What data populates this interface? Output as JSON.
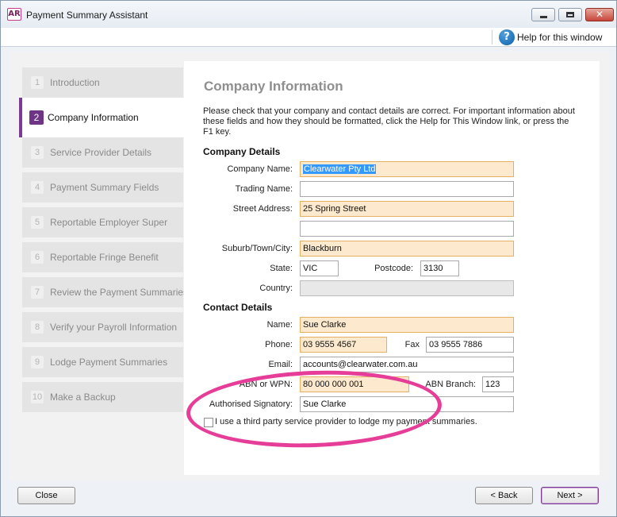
{
  "window": {
    "icon_text": "AR",
    "title": "Payment Summary Assistant",
    "help_link": "Help for this window"
  },
  "steps": [
    {
      "num": "1",
      "label": "Introduction",
      "active": false
    },
    {
      "num": "2",
      "label": "Company Information",
      "active": true
    },
    {
      "num": "3",
      "label": "Service Provider Details",
      "active": false
    },
    {
      "num": "4",
      "label": "Payment Summary Fields",
      "active": false
    },
    {
      "num": "5",
      "label": "Reportable Employer Super",
      "active": false
    },
    {
      "num": "6",
      "label": "Reportable Fringe Benefit",
      "active": false
    },
    {
      "num": "7",
      "label": "Review the Payment Summaries",
      "active": false
    },
    {
      "num": "8",
      "label": "Verify your Payroll Information",
      "active": false
    },
    {
      "num": "9",
      "label": "Lodge Payment Summaries",
      "active": false
    },
    {
      "num": "10",
      "label": "Make a Backup",
      "active": false
    }
  ],
  "main": {
    "heading": "Company Information",
    "intro": "Please check that your company and contact details are correct. For important information about these fields and how they should be formatted, click the Help for This Window link, or press the F1 key.",
    "company_section": "Company Details",
    "contact_section": "Contact Details"
  },
  "fields": {
    "company_name": {
      "label": "Company Name:",
      "value": "Clearwater Pty Ltd"
    },
    "trading_name": {
      "label": "Trading Name:",
      "value": ""
    },
    "street_address": {
      "label": "Street Address:",
      "value": "25 Spring Street"
    },
    "street_address2": {
      "value": ""
    },
    "suburb": {
      "label": "Suburb/Town/City:",
      "value": "Blackburn"
    },
    "state": {
      "label": "State:",
      "value": "VIC"
    },
    "postcode": {
      "label": "Postcode:",
      "value": "3130"
    },
    "country": {
      "label": "Country:",
      "value": ""
    },
    "contact_name": {
      "label": "Name:",
      "value": "Sue Clarke"
    },
    "phone": {
      "label": "Phone:",
      "value": "03 9555 4567"
    },
    "fax": {
      "label": "Fax",
      "value": "03 9555 7886"
    },
    "email": {
      "label": "Email:",
      "value": "accounts@clearwater.com.au"
    },
    "abn": {
      "label": "ABN or WPN:",
      "value": "80 000 000 001"
    },
    "abn_branch": {
      "label": "ABN Branch:",
      "value": "123"
    },
    "signatory": {
      "label": "Authorised Signatory:",
      "value": "Sue Clarke"
    }
  },
  "third_party": {
    "label": "I use a third party service provider to lodge my payment summaries.",
    "checked": false
  },
  "buttons": {
    "close": "Close",
    "back": "< Back",
    "next": "Next >"
  },
  "colors": {
    "accent": "#6e3485",
    "required_fill": "#fde9cd",
    "highlight": "#e63d98"
  }
}
